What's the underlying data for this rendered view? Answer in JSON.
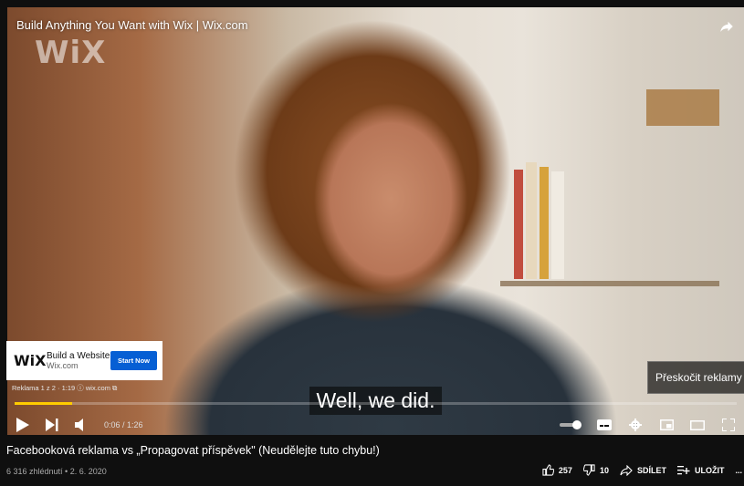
{
  "player": {
    "overlay_title": "Build Anything You Want with Wix | Wix.com",
    "watermark": "WiX",
    "subtitle": "Well, we did.",
    "progress_fraction": 0.08,
    "time_display": "0:06 / 1:26",
    "accent_color": "#ffcc00"
  },
  "ad": {
    "logo": "WiX",
    "title": "Build a Website",
    "url": "Wix.com",
    "button_label": "Start Now",
    "info": "Reklama 1 z 2 · 1:19 ⓘ  wix.com ⧉",
    "button_color": "#065fd4"
  },
  "skip": {
    "label": "Přeskočit reklamy",
    "icon": "skip-next-icon"
  },
  "controls": {
    "play": "play-icon",
    "next": "next-icon",
    "volume": "volume-icon",
    "autoplay": "autoplay-toggle",
    "captions": "captions-icon",
    "settings": "gear-icon",
    "miniplayer": "miniplayer-icon",
    "theater": "theater-icon",
    "fullscreen": "fullscreen-icon"
  },
  "video": {
    "title": "Facebooková reklama vs „Propagovat příspěvek\" (Neudělejte tuto chybu!)",
    "meta": "6 316 zhlédnutí • 2. 6. 2020"
  },
  "actions": {
    "likes": "257",
    "dislikes": "10",
    "share": "SDÍLET",
    "save": "ULOŽIT",
    "more": "..."
  }
}
